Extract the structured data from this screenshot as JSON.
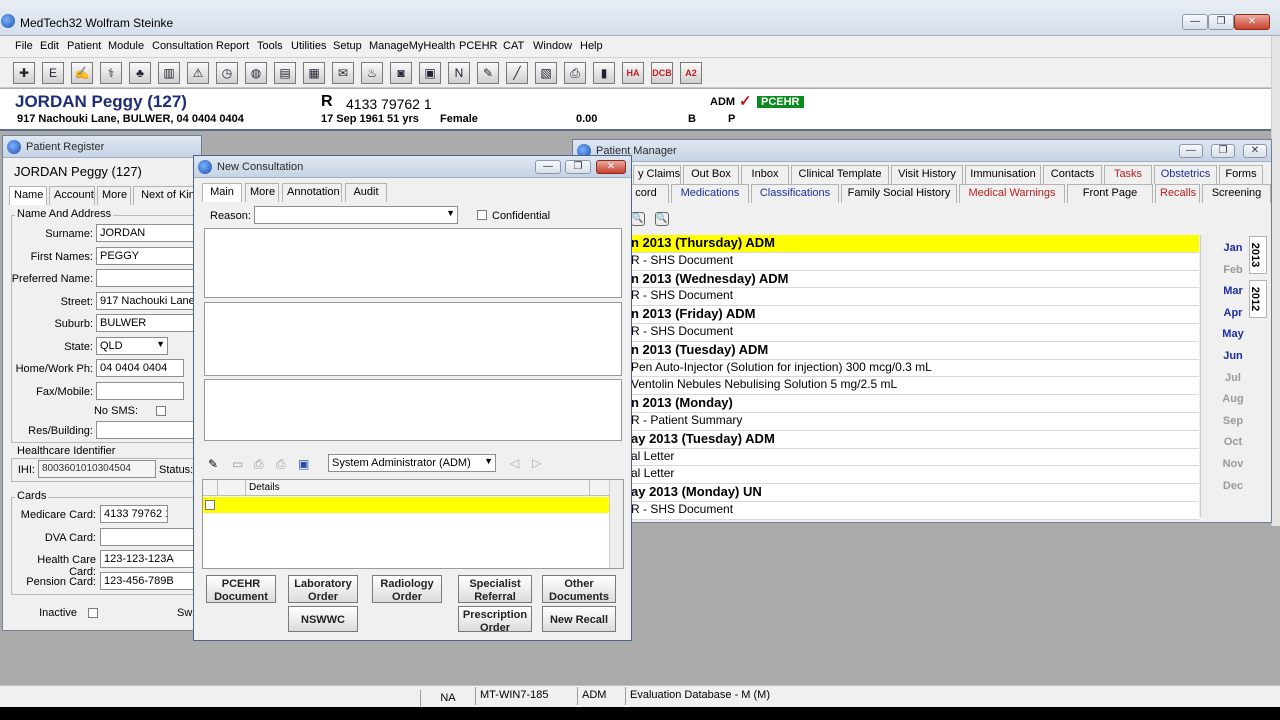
{
  "app": {
    "title": "MedTech32  Wolfram Steinke"
  },
  "menu": [
    {
      "label": "File"
    },
    {
      "label": "Edit"
    },
    {
      "label": "Patient"
    },
    {
      "label": "Module"
    },
    {
      "label": "Consultation"
    },
    {
      "label": "Report"
    },
    {
      "label": "Tools"
    },
    {
      "label": "Utilities"
    },
    {
      "label": "Setup"
    },
    {
      "label": "ManageMyHealth"
    },
    {
      "label": "PCEHR"
    },
    {
      "label": "CAT"
    },
    {
      "label": "Window"
    },
    {
      "label": "Help"
    }
  ],
  "toolbar_icons": [
    "health-icon",
    "e-icon",
    "pen-icon",
    "stethoscope-icon",
    "tree-icon",
    "barcode-icon",
    "warning-icon",
    "clock-icon",
    "globe-icon",
    "form-icon",
    "pdf-icon",
    "email-icon",
    "pig-icon",
    "camera-icon",
    "scan-icon",
    "neo-icon",
    "pencil-icon",
    "syringe-icon",
    "chart-icon",
    "printer-icon",
    "graph-icon",
    "ha-icon",
    "dcb-icon",
    "a2-icon"
  ],
  "toolbar_labels": {
    "ha": "HA",
    "dcb": "DCB",
    "a2": "A2"
  },
  "patient": {
    "name": "JORDAN Peggy (127)",
    "address": "917 Nachouki Lane, BULWER, 04 0404 0404",
    "r_label": "R",
    "medicare": "4133 79762 1",
    "dob_age": "17 Sep 1961 51 yrs",
    "sex": "Female",
    "balance": "0.00",
    "b": "B",
    "p": "P",
    "user": "ADM",
    "check": "✓",
    "pcehr": "PCEHR"
  },
  "register": {
    "title": "Patient Register",
    "heading": "JORDAN Peggy (127)",
    "tabs": [
      "Name",
      "Account",
      "More",
      "Next of Kin"
    ],
    "section_name": "Name And Address",
    "labels": {
      "surname": "Surname:",
      "first": "First Names:",
      "preferred": "Preferred Name:",
      "street": "Street:",
      "suburb": "Suburb:",
      "state": "State:",
      "phone": "Home/Work Ph:",
      "fax": "Fax/Mobile:",
      "nosms": "No SMS:",
      "res": "Res/Building:",
      "ihi": "IHI:",
      "status": "Status:",
      "medicare": "Medicare Card:",
      "dva": "DVA Card:",
      "hcc": "Health Care Card:",
      "pension": "Pension Card:",
      "inactive": "Inactive"
    },
    "values": {
      "surname": "JORDAN",
      "first": "PEGGY",
      "preferred": "",
      "street": "917 Nachouki Lane",
      "suburb": "BULWER",
      "state": "QLD",
      "phone": "04 0404 0404",
      "fax": "",
      "ihi": "8003601010304504",
      "medicare": "4133 79762 1",
      "dva": "",
      "hcc": "123-123-123A",
      "pension": "123-456-789B"
    },
    "section_health": "Healthcare Identifier",
    "section_cards": "Cards",
    "extra_button": "Sw"
  },
  "consult": {
    "title": "New Consultation",
    "tabs": [
      "Main",
      "More",
      "Annotation",
      "Audit"
    ],
    "reason_label": "Reason:",
    "reason_value": "",
    "confidential": "Confidential",
    "provider": "System Administrator (ADM)",
    "details_header": "Details",
    "buttons": [
      [
        "PCEHR",
        "Document"
      ],
      [
        "Laboratory",
        "Order"
      ],
      [
        "Radiology",
        "Order"
      ],
      [
        "Specialist",
        "Referral"
      ],
      [
        "Other",
        "Documents"
      ],
      [
        "NSWWC"
      ],
      [
        "Prescription",
        "Order"
      ],
      [
        "New Recall"
      ]
    ]
  },
  "manager": {
    "title": "Patient Manager",
    "tabs_row1": [
      {
        "label": "y Claims",
        "color": "normal"
      },
      {
        "label": "Out Box",
        "color": "normal"
      },
      {
        "label": "Inbox",
        "color": "normal"
      },
      {
        "label": "Clinical Template",
        "color": "normal"
      },
      {
        "label": "Visit History",
        "color": "normal"
      },
      {
        "label": "Immunisation",
        "color": "normal"
      },
      {
        "label": "Contacts",
        "color": "normal"
      },
      {
        "label": "Tasks",
        "color": "red"
      },
      {
        "label": "Obstetrics",
        "color": "blue"
      },
      {
        "label": "Forms",
        "color": "normal"
      }
    ],
    "tabs_row2": [
      {
        "label": "cord",
        "color": "normal"
      },
      {
        "label": "Medications",
        "color": "blue"
      },
      {
        "label": "Classifications",
        "color": "blue"
      },
      {
        "label": "Family Social History",
        "color": "normal"
      },
      {
        "label": "Medical Warnings",
        "color": "red"
      },
      {
        "label": "Front Page",
        "color": "normal"
      },
      {
        "label": "Recalls",
        "color": "red"
      },
      {
        "label": "Screening",
        "color": "normal"
      }
    ],
    "rows": [
      {
        "text": "n 2013 (Thursday) ADM",
        "type": "header",
        "hl": true
      },
      {
        "text": "R - SHS Document",
        "type": "item"
      },
      {
        "text": "n 2013 (Wednesday) ADM",
        "type": "header"
      },
      {
        "text": "R - SHS Document",
        "type": "item"
      },
      {
        "text": "n 2013 (Friday) ADM",
        "type": "header"
      },
      {
        "text": "R - SHS Document",
        "type": "item"
      },
      {
        "text": "n 2013 (Tuesday) ADM",
        "type": "header"
      },
      {
        "text": "Pen Auto-Injector (Solution for injection) 300 mcg/0.3 mL",
        "type": "item"
      },
      {
        "text": "Ventolin Nebules Nebulising Solution 5 mg/2.5 mL",
        "type": "item"
      },
      {
        "text": "n 2013 (Monday)",
        "type": "header"
      },
      {
        "text": "R - Patient Summary",
        "type": "item"
      },
      {
        "text": "ay 2013 (Tuesday) ADM",
        "type": "header"
      },
      {
        "text": "al Letter",
        "type": "item"
      },
      {
        "text": "al Letter",
        "type": "item"
      },
      {
        "text": "ay 2013 (Monday) UN",
        "type": "header"
      },
      {
        "text": "R - SHS Document",
        "type": "item"
      }
    ],
    "months": [
      {
        "label": "Jan",
        "on": true
      },
      {
        "label": "Feb",
        "on": false
      },
      {
        "label": "Mar",
        "on": true
      },
      {
        "label": "Apr",
        "on": true
      },
      {
        "label": "May",
        "on": true
      },
      {
        "label": "Jun",
        "on": true
      },
      {
        "label": "Jul",
        "on": false
      },
      {
        "label": "Aug",
        "on": false
      },
      {
        "label": "Sep",
        "on": false
      },
      {
        "label": "Oct",
        "on": false
      },
      {
        "label": "Nov",
        "on": false
      },
      {
        "label": "Dec",
        "on": false
      }
    ],
    "years": [
      "2013",
      "2012"
    ]
  },
  "statusbar": {
    "na": "NA",
    "machine": "MT-WIN7-185",
    "user": "ADM",
    "database": "Evaluation Database - M (M)"
  },
  "colors": {
    "highlight": "#ffff00",
    "patient_name": "#1d2c79",
    "pcehr_badge": "#0a8a1f"
  }
}
